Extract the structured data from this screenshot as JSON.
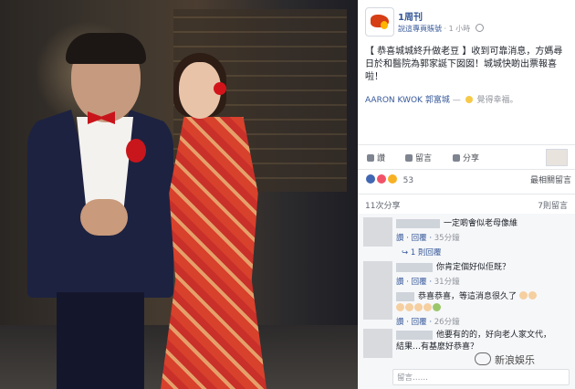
{
  "post": {
    "page_name": "1周刊",
    "meta_link": "說這專頁賬號",
    "time": "1 小時",
    "body": "【 恭喜城城終升做老豆 】收到可靠消息，方媽尋日於和醫院為郭家誕下囡囡！城城快啲出票報喜啦！",
    "tag_name": "AARON KWOK 郭富城",
    "feeling": "覺得幸福。"
  },
  "actions": {
    "like": "讚",
    "comment": "留言",
    "share": "分享"
  },
  "reactions": {
    "count": "53",
    "sort": "最相關留言"
  },
  "shares": {
    "shares_text": "11次分享",
    "comments_text": "7則留言"
  },
  "comments": [
    {
      "text": "一定啲會似老母像維",
      "like": "讚",
      "reply": "回覆",
      "time": "35分鐘",
      "replies": "1 則回覆"
    },
    {
      "text": "你肯定個好似佢既？",
      "like": "讚",
      "reply": "回覆",
      "time": "31分鐘"
    },
    {
      "text": "恭喜恭喜，等這消息很久了",
      "like": "讚",
      "reply": "回覆",
      "time": "26分鐘"
    },
    {
      "text": "他要有的的，好向老人家文代，",
      "text2": "結果…有基麼好恭喜？"
    }
  ],
  "input_placeholder": "留言……",
  "watermark": "新浪娛乐",
  "colors": {
    "link": "#365899",
    "like_reaction": "#4267b2",
    "love_reaction": "#f25268",
    "haha_reaction": "#f7b125"
  }
}
